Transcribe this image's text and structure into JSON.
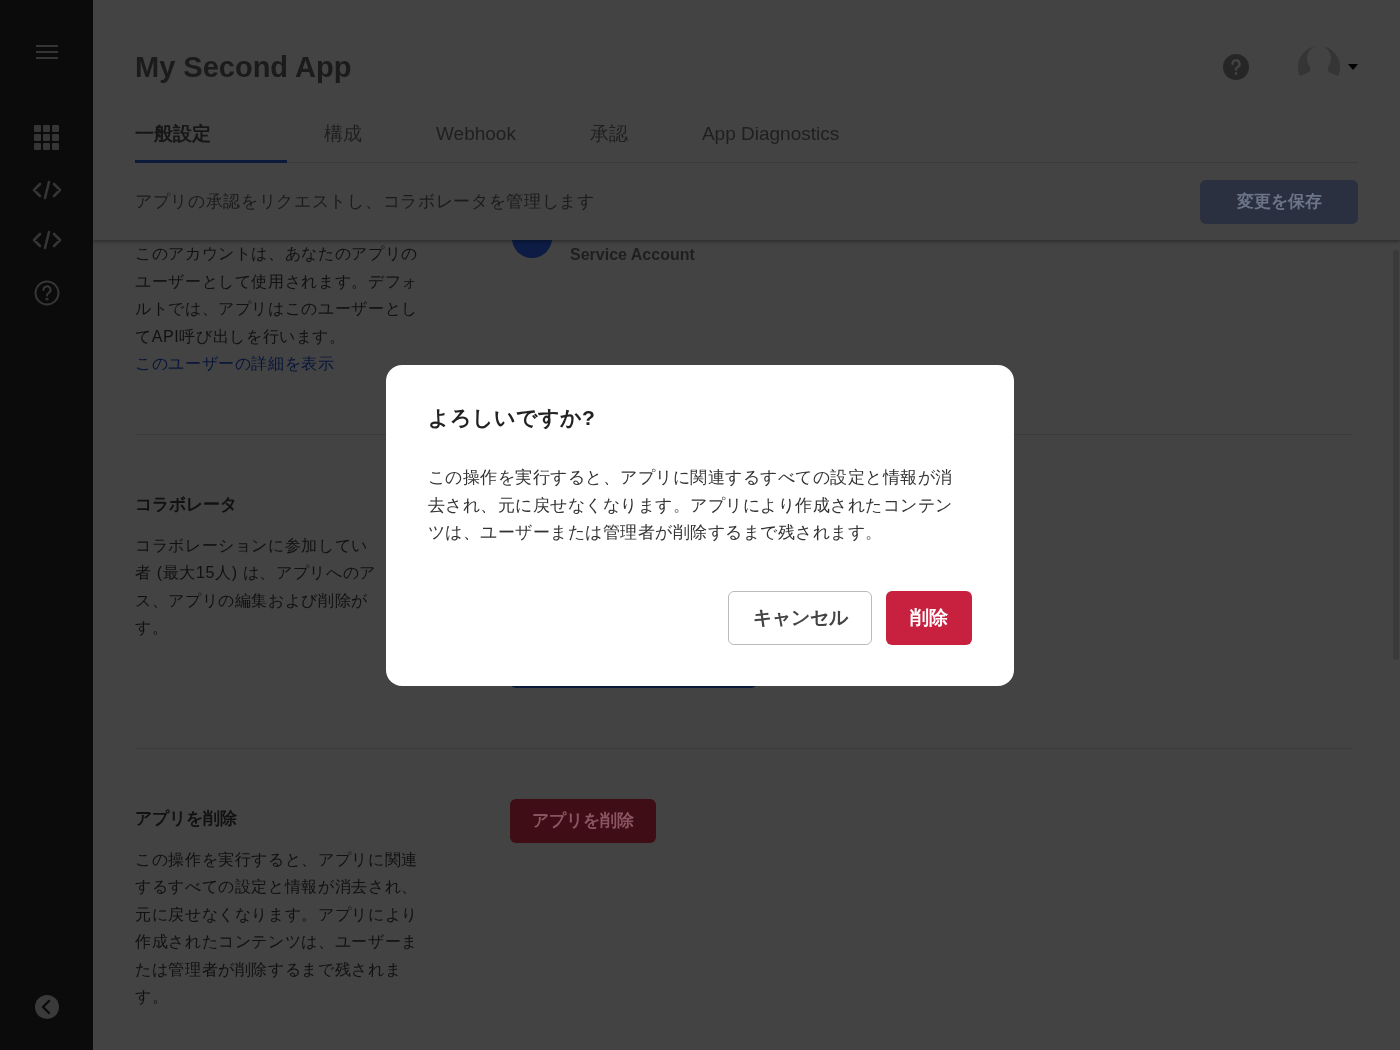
{
  "header": {
    "title": "My Second App"
  },
  "tabs": [
    {
      "label": "一般設定",
      "selected": true
    },
    {
      "label": "構成",
      "selected": false
    },
    {
      "label": "Webhook",
      "selected": false
    },
    {
      "label": "承認",
      "selected": false
    },
    {
      "label": "App Diagnostics",
      "selected": false
    }
  ],
  "subheader": {
    "text": "アプリの承認をリクエストし、コラボレータを管理します",
    "save_button": "変更を保存"
  },
  "sections": [
    {
      "kind": "service_account",
      "description": "このアカウントは、あなたのアプリのユーザーとして使用されます。デフォルトでは、アプリはこのユーザーとしてAPI呼び出しを行います。",
      "link": "このユーザーの詳細を表示",
      "account_label": "Service Account"
    },
    {
      "kind": "collaborators",
      "heading": "コラボレータ",
      "description_lines": [
        "コラボレーションに参加してい",
        "者 (最大15人) は、アプリへのア",
        "ス、アプリの編集および削除が",
        "す。"
      ]
    },
    {
      "kind": "delete_app",
      "heading": "アプリを削除",
      "description": "この操作を実行すると、アプリに関連するすべての設定と情報が消去され、元に戻せなくなります。アプリにより作成されたコンテンツは、ユーザーまたは管理者が削除するまで残されます。",
      "button": "アプリを削除"
    }
  ],
  "dialog": {
    "title": "よろしいですか?",
    "body": "この操作を実行すると、アプリに関連するすべての設定と情報が消去され、元に戻せなくなります。アプリにより作成されたコンテンツは、ユーザーまたは管理者が削除するまで残されます。",
    "cancel_button": "キャンセル",
    "delete_button": "削除"
  }
}
